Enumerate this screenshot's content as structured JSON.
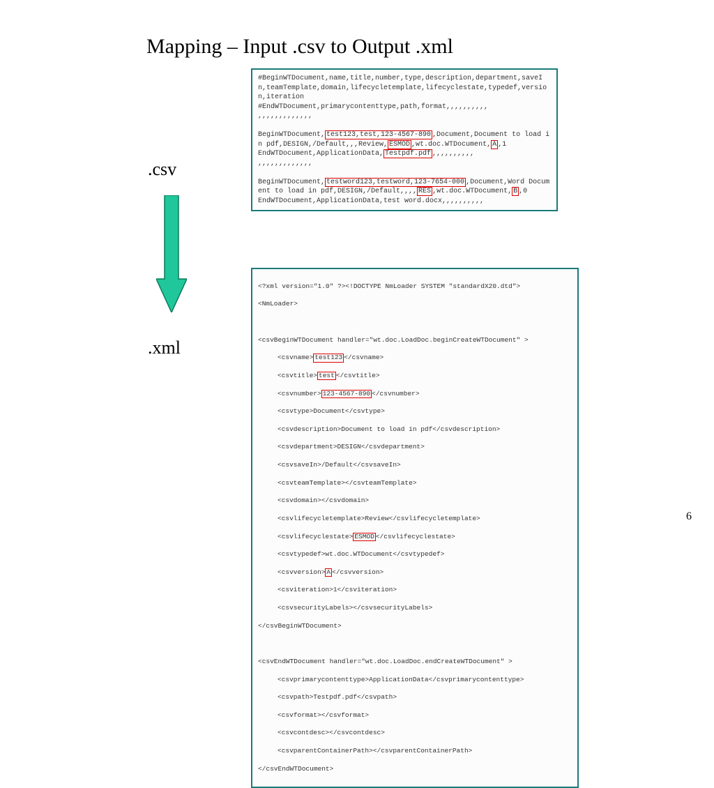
{
  "title": "Mapping – Input .csv to Output .xml",
  "csvLabel": ".csv",
  "xmlLabel": ".xml",
  "pageNum": "6",
  "csv": {
    "header1": "#BeginWTDocument,name,title,number,type,description,department,saveIn,teamTemplate,domain,lifecycletemplate,lifecyclestate,typedef,version,iteration",
    "header2": "#EndWTDocument,primarycontenttype,path,format,,,,,,,,,,",
    "commas": ",,,,,,,,,,,,,",
    "r1_a": "BeginWTDocument,",
    "r1_h1": "test123,test,123-4567-890",
    "r1_b": ",Document,Document to load in pdf,DESIGN,/Default,,,Review,",
    "r1_h2": "ESMOD",
    "r1_c": ",wt.doc.WTDocument,",
    "r1_h3": "A",
    "r1_d": ",1",
    "r1_end_a": "EndWTDocument,ApplicationData,",
    "r1_end_h": "Testpdf.pdf",
    "r1_end_b": ",,,,,,,,,,",
    "r2_a": "BeginWTDocument,",
    "r2_h1": "testword123,testword,123-7654-000",
    "r2_b": ",Document,Word Document to load in pdf,DESIGN,/Default,,,,",
    "r2_h2": "RES",
    "r2_c": ",wt.doc.WTDocument,",
    "r2_h3": "B",
    "r2_d": ",0",
    "r2_end": "EndWTDocument,ApplicationData,test word.docx,,,,,,,,,,"
  },
  "xml": {
    "l0": "<?xml version=\"1.0\" ?><!DOCTYPE NmLoader SYSTEM \"standardX20.dtd\">",
    "l1": "<NmLoader>",
    "l2a": "<csvBeginWTDocument handler=\"wt.doc.LoadDoc.beginCreateWTDocument\" >",
    "name_a": "<csvname>",
    "name_h": "test123",
    "name_b": "</csvname>",
    "title_a": "<csvtitle>",
    "title_h": "test",
    "title_b": "</csvtitle>",
    "num_a": "<csvnumber>",
    "num_h": "123-4567-890",
    "num_b": "</csvnumber>",
    "type": "<csvtype>Document</csvtype>",
    "desc": "<csvdescription>Document to load in pdf</csvdescription>",
    "dept": "<csvdepartment>DESIGN</csvdepartment>",
    "save": "<csvsaveIn>/Default</csvsaveIn>",
    "team": "<csvteamTemplate></csvteamTemplate>",
    "dom": "<csvdomain></csvdomain>",
    "lct": "<csvlifecycletemplate>Review</csvlifecycletemplate>",
    "lcs_a": "<csvlifecyclestate>",
    "lcs_h": "ESMOD",
    "lcs_b": "</csvlifecyclestate>",
    "tdef": "<csvtypedef>wt.doc.WTDocument</csvtypedef>",
    "ver_a": "<csvversion>",
    "ver_h": "A",
    "ver_b": "</csvversion>",
    "iter": "<csviteration>1</csviteration>",
    "sec": "<csvsecurityLabels></csvsecurityLabels>",
    "l2b": "</csvBeginWTDocument>",
    "l3a": "<csvEndWTDocument handler=\"wt.doc.LoadDoc.endCreateWTDocument\" >",
    "pct": "<csvprimarycontenttype>ApplicationData</csvprimarycontenttype>",
    "path": "<csvpath>Testpdf.pdf</csvpath>",
    "fmt": "<csvformat></csvformat>",
    "cdesc": "<csvcontdesc></csvcontdesc>",
    "pcp": "<csvparentContainerPath></csvparentContainerPath>",
    "l3b": "</csvEndWTDocument>"
  }
}
